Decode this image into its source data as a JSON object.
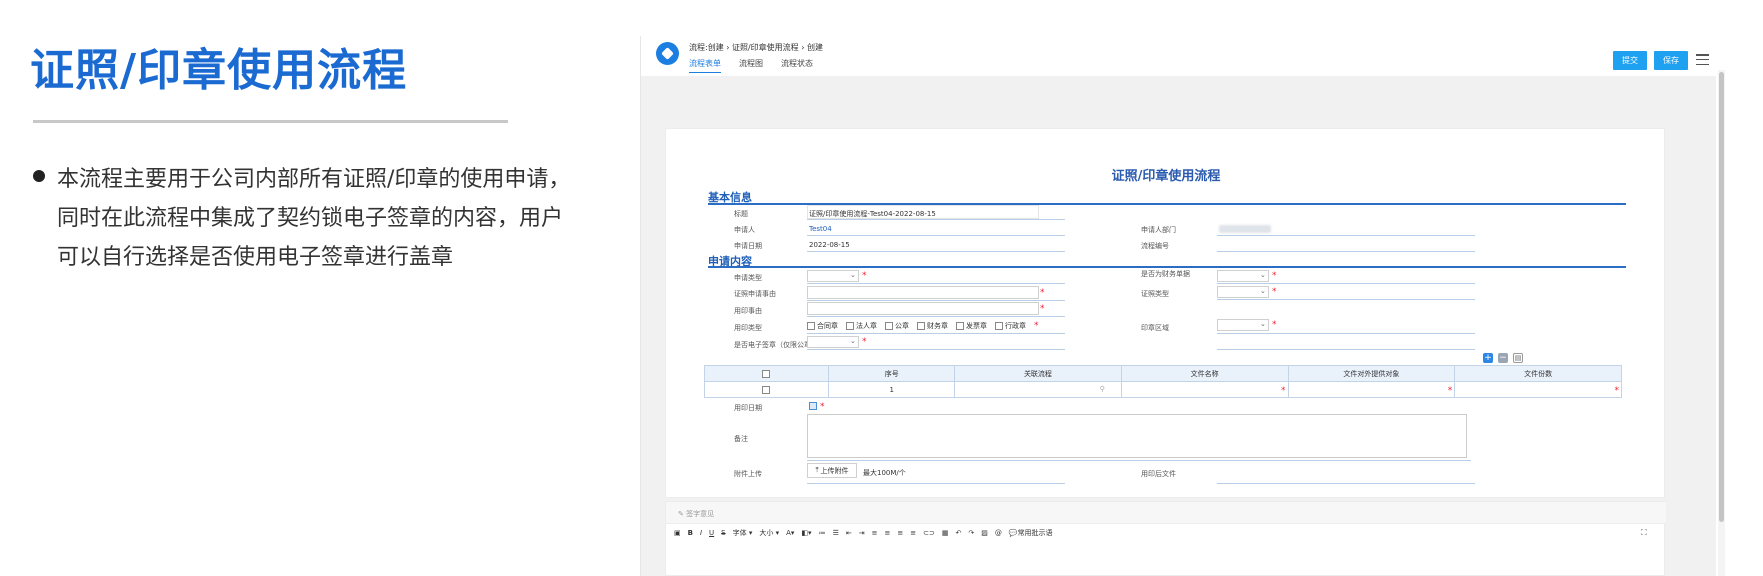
{
  "left": {
    "title": "证照/印章使用流程",
    "bullet": "本流程主要用于公司内部所有证照/印章的使用申请，同时在此流程中集成了契约锁电子签章的内容，用户可以自行选择是否使用电子签章进行盖章"
  },
  "app": {
    "breadcrumb": "流程:创建 › 证照/印章使用流程 › 创建",
    "tabs": [
      "流程表单",
      "流程图",
      "流程状态"
    ],
    "submit_label": "提交",
    "save_label": "保存",
    "accent": "#1fa1f1"
  },
  "form": {
    "title": "证照/印章使用流程",
    "basic_section": "基本信息",
    "apply_section": "申请内容",
    "basic": {
      "title_label": "标题",
      "title_value": "证照/印章使用流程-Test04-2022-08-15",
      "applicant_label": "申请人",
      "applicant_value": "Test04",
      "dept_label": "申请人部门",
      "date_label": "申请日期",
      "date_value": "2022-08-15",
      "flow_no_label": "流程编号"
    },
    "apply": {
      "apply_type_label": "申请类型",
      "is_finance_label": "是否为财务单据",
      "license_reason_label": "证照申请事由",
      "license_type_label": "证照类型",
      "stamp_reason_label": "用印事由",
      "stamp_type_label": "用印类型",
      "stamp_types": [
        "合同章",
        "法人章",
        "公章",
        "财务章",
        "发票章",
        "行政章"
      ],
      "stamp_area_label": "印章区域",
      "esign_label": "是否电子签章（仅限公章）"
    },
    "table": {
      "headers": [
        "",
        "序号",
        "关联流程",
        "文件名称",
        "文件对外提供对象",
        "文件份数"
      ],
      "row_no": "1"
    },
    "stamp_date_label": "用印日期",
    "remark_label": "备注",
    "attach_label": "附件上传",
    "upload_button": "上传附件",
    "upload_limit": "最大100M/个",
    "stamped_file_label": "用印后文件"
  },
  "comment": {
    "header": "签字意见",
    "font_label": "字体",
    "size_label": "大小",
    "common_phrase": "常用批示语"
  }
}
